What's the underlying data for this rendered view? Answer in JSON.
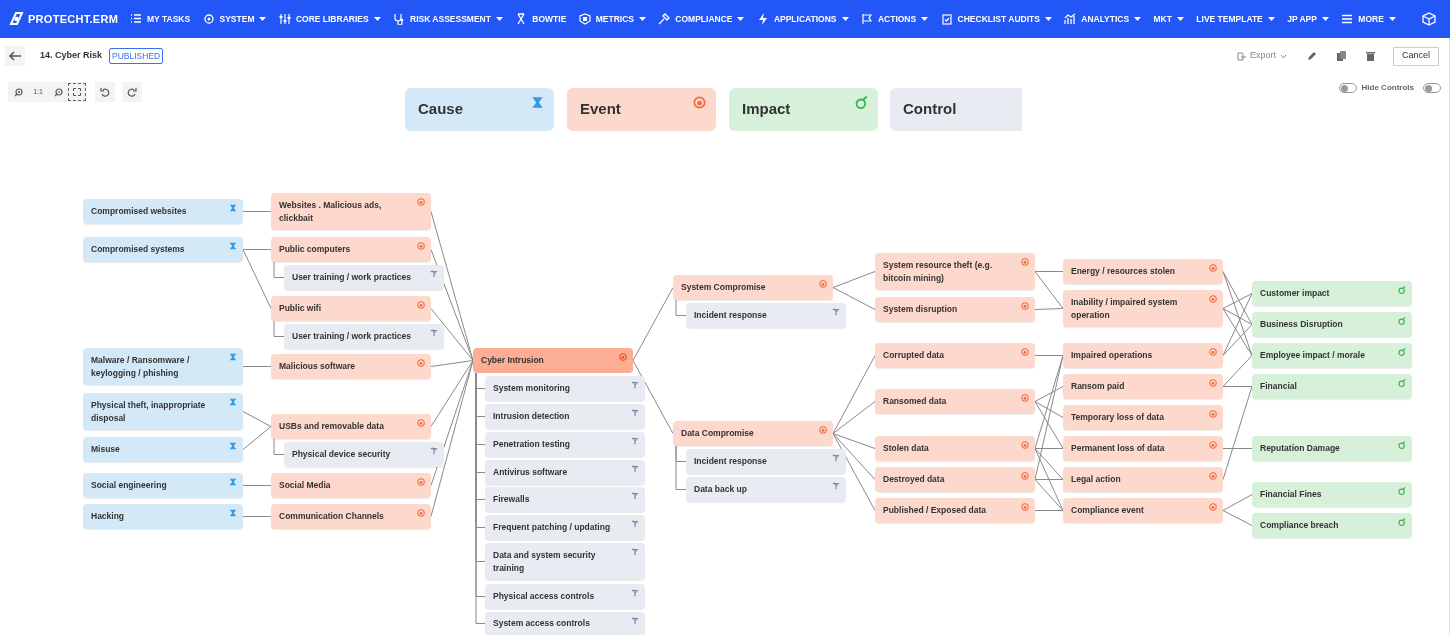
{
  "nav": {
    "logo": "PROTECHT.ERM",
    "items": [
      {
        "label": "MY TASKS",
        "has_menu": false
      },
      {
        "label": "SYSTEM",
        "has_menu": true
      },
      {
        "label": "CORE LIBRARIES",
        "has_menu": true
      },
      {
        "label": "RISK ASSESSMENT",
        "has_menu": true
      },
      {
        "label": "BOWTIE",
        "has_menu": false
      },
      {
        "label": "METRICS",
        "has_menu": true
      },
      {
        "label": "COMPLIANCE",
        "has_menu": true
      },
      {
        "label": "APPLICATIONS",
        "has_menu": true
      },
      {
        "label": "ACTIONS",
        "has_menu": true
      },
      {
        "label": "CHECKLIST AUDITS",
        "has_menu": true
      },
      {
        "label": "ANALYTICS",
        "has_menu": true
      },
      {
        "label": "MKT",
        "has_menu": true
      },
      {
        "label": "LIVE TEMPLATE",
        "has_menu": true
      },
      {
        "label": "JP APP",
        "has_menu": true
      },
      {
        "label": "MORE",
        "has_menu": true
      }
    ]
  },
  "header": {
    "title": "14. Cyber Risk",
    "status": "PUBLISHED",
    "export": "Export",
    "cancel": "Cancel"
  },
  "zoom_toolbar": {
    "actual_size": "1:1"
  },
  "toggles": [
    {
      "on": false
    },
    {
      "label": "Hide Controls",
      "on": false
    }
  ],
  "legend": [
    {
      "label": "Cause",
      "kind": "cause"
    },
    {
      "label": "Event",
      "kind": "event"
    },
    {
      "label": "Impact",
      "kind": "impact"
    },
    {
      "label": "Control",
      "kind": "control"
    }
  ],
  "nodes": [
    {
      "label": "Compromised websites",
      "kind": "cause"
    },
    {
      "label": "Compromised systems",
      "kind": "cause"
    },
    {
      "label": "Malware / Ransomware / keylogging / phishing",
      "kind": "cause"
    },
    {
      "label": "Physical theft, inappropriate disposal",
      "kind": "cause"
    },
    {
      "label": "Misuse",
      "kind": "cause"
    },
    {
      "label": "Social engineering",
      "kind": "cause"
    },
    {
      "label": "Hacking",
      "kind": "cause"
    },
    {
      "label": "Websites . Malicious ads, clickbait",
      "kind": "event"
    },
    {
      "label": "Public computers",
      "kind": "event"
    },
    {
      "label": "User training / work practices",
      "kind": "control"
    },
    {
      "label": "Public wifi",
      "kind": "event"
    },
    {
      "label": "User training / work practices",
      "kind": "control"
    },
    {
      "label": "Malicious software",
      "kind": "event"
    },
    {
      "label": "USBs and removable data",
      "kind": "event"
    },
    {
      "label": "Physical device security",
      "kind": "control"
    },
    {
      "label": "Social Media",
      "kind": "event"
    },
    {
      "label": "Communication Channels",
      "kind": "event"
    },
    {
      "label": "Cyber Intrusion",
      "kind": "top"
    },
    {
      "label": "System monitoring",
      "kind": "control"
    },
    {
      "label": "Intrusion detection",
      "kind": "control"
    },
    {
      "label": "Penetration testing",
      "kind": "control"
    },
    {
      "label": "Antivirus software",
      "kind": "control"
    },
    {
      "label": "Firewalls",
      "kind": "control"
    },
    {
      "label": "Frequent patching / updating",
      "kind": "control"
    },
    {
      "label": "Data and system security training",
      "kind": "control"
    },
    {
      "label": "Physical access controls",
      "kind": "control"
    },
    {
      "label": "System access controls",
      "kind": "control"
    },
    {
      "label": "System Compromise",
      "kind": "event"
    },
    {
      "label": "Incident response",
      "kind": "control"
    },
    {
      "label": "Data Compromise",
      "kind": "event"
    },
    {
      "label": "Incident response",
      "kind": "control"
    },
    {
      "label": "Data back up",
      "kind": "control"
    },
    {
      "label": "System resource theft (e.g. bitcoin mining)",
      "kind": "event"
    },
    {
      "label": "System disruption",
      "kind": "event"
    },
    {
      "label": "Corrupted data",
      "kind": "event"
    },
    {
      "label": "Ransomed data",
      "kind": "event"
    },
    {
      "label": "Stolen data",
      "kind": "event"
    },
    {
      "label": "Destroyed data",
      "kind": "event"
    },
    {
      "label": "Published / Exposed data",
      "kind": "event"
    },
    {
      "label": "Energy / resources stolen",
      "kind": "event"
    },
    {
      "label": "Inability / impaired system operation",
      "kind": "event"
    },
    {
      "label": "Impaired operations",
      "kind": "event"
    },
    {
      "label": "Ransom paid",
      "kind": "event"
    },
    {
      "label": "Temporary loss of data",
      "kind": "event"
    },
    {
      "label": "Permanent loss of data",
      "kind": "event"
    },
    {
      "label": "Legal action",
      "kind": "event"
    },
    {
      "label": "Compliance event",
      "kind": "event"
    },
    {
      "label": "Customer impact",
      "kind": "impact"
    },
    {
      "label": "Business Disruption",
      "kind": "impact"
    },
    {
      "label": "Employee impact / morale",
      "kind": "impact"
    },
    {
      "label": "Financial",
      "kind": "impact"
    },
    {
      "label": "Reputation Damage",
      "kind": "impact"
    },
    {
      "label": "Financial Fines",
      "kind": "impact"
    },
    {
      "label": "Compliance breach",
      "kind": "impact"
    }
  ]
}
